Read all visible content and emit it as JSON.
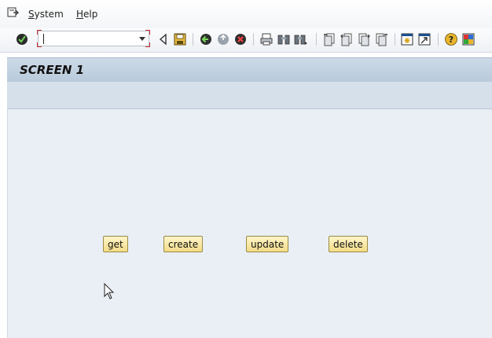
{
  "menubar": {
    "items": [
      {
        "label_ul": "S",
        "label_rest": "ystem"
      },
      {
        "label_ul": "H",
        "label_rest": "elp"
      }
    ]
  },
  "toolbar": {
    "command_field": {
      "value": "",
      "placeholder": ""
    },
    "icons": [
      "enter-check-icon",
      "back-triangle-icon",
      "save-icon",
      "back-green-icon",
      "exit-icon",
      "cancel-icon",
      "print-icon",
      "find-icon",
      "find-next-icon",
      "first-page-icon",
      "previous-page-icon",
      "next-page-icon",
      "last-page-icon",
      "create-session-icon",
      "shortcut-icon",
      "help-icon",
      "customize-layout-icon"
    ]
  },
  "screen": {
    "title": "SCREEN 1"
  },
  "buttons": {
    "get": "get",
    "create": "create",
    "update": "update",
    "delete": "delete"
  },
  "colors": {
    "title_bar": "#c3d3e3",
    "content_bg": "#e9eff5",
    "button_bg": "#f7e7a6",
    "button_border": "#9a8a45"
  }
}
